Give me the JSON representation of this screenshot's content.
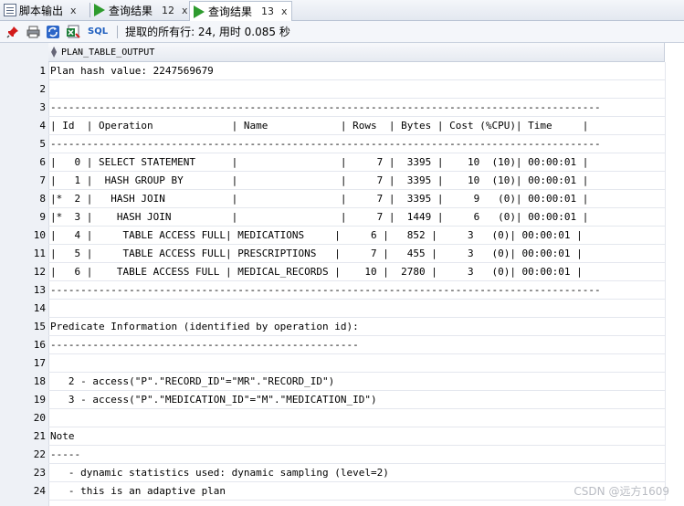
{
  "tabs": [
    {
      "label": "脚本输出",
      "close": "x",
      "icon": "document-icon",
      "active": false
    },
    {
      "label": "查询结果",
      "number": "12",
      "close": "x",
      "icon": "play-icon",
      "active": false
    },
    {
      "label": "查询结果",
      "number": "13",
      "close": "x",
      "icon": "play-icon",
      "active": true
    }
  ],
  "toolbar": {
    "sql_label": "SQL",
    "status": "提取的所有行: 24, 用时 0.085 秒"
  },
  "grid": {
    "column_header": "PLAN_TABLE_OUTPUT",
    "rows": [
      {
        "n": "1",
        "text": "Plan hash value: 2247569679"
      },
      {
        "n": "2",
        "text": ""
      },
      {
        "n": "3",
        "text": "-------------------------------------------------------------------------------------------"
      },
      {
        "n": "4",
        "text": "| Id  | Operation             | Name            | Rows  | Bytes | Cost (%CPU)| Time     |"
      },
      {
        "n": "5",
        "text": "-------------------------------------------------------------------------------------------"
      },
      {
        "n": "6",
        "text": "|   0 | SELECT STATEMENT      |                 |     7 |  3395 |    10  (10)| 00:00:01 |"
      },
      {
        "n": "7",
        "text": "|   1 |  HASH GROUP BY        |                 |     7 |  3395 |    10  (10)| 00:00:01 |"
      },
      {
        "n": "8",
        "text": "|*  2 |   HASH JOIN           |                 |     7 |  3395 |     9   (0)| 00:00:01 |"
      },
      {
        "n": "9",
        "text": "|*  3 |    HASH JOIN          |                 |     7 |  1449 |     6   (0)| 00:00:01 |"
      },
      {
        "n": "10",
        "text": "|   4 |     TABLE ACCESS FULL| MEDICATIONS     |     6 |   852 |     3   (0)| 00:00:01 |"
      },
      {
        "n": "11",
        "text": "|   5 |     TABLE ACCESS FULL| PRESCRIPTIONS   |     7 |   455 |     3   (0)| 00:00:01 |"
      },
      {
        "n": "12",
        "text": "|   6 |    TABLE ACCESS FULL | MEDICAL_RECORDS |    10 |  2780 |     3   (0)| 00:00:01 |"
      },
      {
        "n": "13",
        "text": "-------------------------------------------------------------------------------------------"
      },
      {
        "n": "14",
        "text": ""
      },
      {
        "n": "15",
        "text": "Predicate Information (identified by operation id):"
      },
      {
        "n": "16",
        "text": "---------------------------------------------------"
      },
      {
        "n": "17",
        "text": ""
      },
      {
        "n": "18",
        "text": "   2 - access(\"P\".\"RECORD_ID\"=\"MR\".\"RECORD_ID\")"
      },
      {
        "n": "19",
        "text": "   3 - access(\"P\".\"MEDICATION_ID\"=\"M\".\"MEDICATION_ID\")"
      },
      {
        "n": "20",
        "text": ""
      },
      {
        "n": "21",
        "text": "Note"
      },
      {
        "n": "22",
        "text": "-----"
      },
      {
        "n": "23",
        "text": "   - dynamic statistics used: dynamic sampling (level=2)"
      },
      {
        "n": "24",
        "text": "   - this is an adaptive plan"
      }
    ]
  },
  "watermark": "CSDN @远方1609"
}
